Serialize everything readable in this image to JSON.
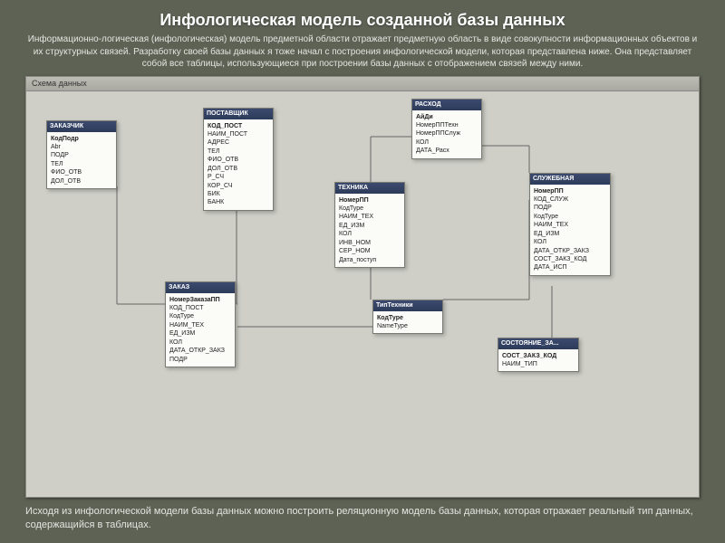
{
  "title": "Инфологическая модель созданной базы данных",
  "intro": "Информационно-логическая (инфологическая) модель предметной области отражает предметную область в виде совокупности информационных объектов и их структурных связей. Разработку своей базы данных я тоже начал с построения инфологической модели, которая представлена ниже. Она представляет собой все таблицы, использующиеся при построении базы данных с отображением связей между ними.",
  "window_title": "Схема данных",
  "outro": "Исходя из инфологической модели базы данных можно построить реляционную модель базы данных, которая отражает реальный тип данных, содержащийся в таблицах.",
  "tables": {
    "zakazchik": {
      "name": "ЗАКАЗЧИК",
      "fields": [
        "КодПодр",
        "Abr",
        "ПОДР",
        "ТЕЛ",
        "ФИО_ОТВ",
        "ДОЛ_ОТВ"
      ]
    },
    "postavshik": {
      "name": "ПОСТАВЩИК",
      "fields": [
        "КОД_ПОСТ",
        "НАИМ_ПОСТ",
        "АДРЕС",
        "ТЕЛ",
        "ФИО_ОТВ",
        "ДОЛ_ОТВ",
        "Р_СЧ",
        "КОР_СЧ",
        "БИК",
        "БАНК"
      ]
    },
    "tehnika": {
      "name": "ТЕХНИКА",
      "fields": [
        "НомерПП",
        "КодТуре",
        "НАИМ_ТЕХ",
        "ЕД_ИЗМ",
        "КОЛ",
        "ИНВ_НОМ",
        "СЕР_НОМ",
        "Дата_поступ"
      ]
    },
    "rashod": {
      "name": "РАСХОД",
      "fields": [
        "АйДи",
        "НомерППТехн",
        "НомерППСлуж",
        "КОЛ",
        "ДАТА_Расх"
      ]
    },
    "sluzhebnaya": {
      "name": "СЛУЖЕБНАЯ",
      "fields": [
        "НомерПП",
        "КОД_СЛУЖ",
        "ПОДР",
        "КодТуре",
        "НАИМ_ТЕХ",
        "ЕД_ИЗМ",
        "КОЛ",
        "ДАТА_ОТКР_ЗАКЗ",
        "СОСТ_ЗАКЗ_КОД",
        "ДАТА_ИСП"
      ]
    },
    "zakaz": {
      "name": "ЗАКАЗ",
      "fields": [
        "НомерЗаказаПП",
        "КОД_ПОСТ",
        "КодТуре",
        "НАИМ_ТЕХ",
        "ЕД_ИЗМ",
        "КОЛ",
        "ДАТА_ОТКР_ЗАКЗ",
        "ПОДР"
      ]
    },
    "tiptehniki": {
      "name": "ТипТехники",
      "fields": [
        "КодТуре",
        "NameType"
      ]
    },
    "sostoyanie": {
      "name": "СОСТОЯНИЕ_ЗА...",
      "fields": [
        "СОСТ_ЗАКЗ_КОД",
        "НАИМ_ТИП"
      ]
    }
  },
  "chart_data": {
    "type": "diagram",
    "title": "Схема данных (ER-модель базы данных)",
    "entities": [
      {
        "id": "zakazchik",
        "name": "ЗАКАЗЧИК",
        "pk": "КодПодр"
      },
      {
        "id": "postavshik",
        "name": "ПОСТАВЩИК",
        "pk": "КОД_ПОСТ"
      },
      {
        "id": "tehnika",
        "name": "ТЕХНИКА",
        "pk": "НомерПП"
      },
      {
        "id": "rashod",
        "name": "РАСХОД",
        "pk": "АйДи"
      },
      {
        "id": "sluzhebnaya",
        "name": "СЛУЖЕБНАЯ",
        "pk": "НомерПП"
      },
      {
        "id": "zakaz",
        "name": "ЗАКАЗ",
        "pk": "НомерЗаказаПП"
      },
      {
        "id": "tiptehniki",
        "name": "ТипТехники",
        "pk": "КодТуре"
      },
      {
        "id": "sostoyanie",
        "name": "СОСТОЯНИЕ_ЗАКАЗА",
        "pk": "СОСТ_ЗАКЗ_КОД"
      }
    ],
    "relationships": [
      {
        "from": "zakazchik",
        "to": "zakaz",
        "type": "1:N"
      },
      {
        "from": "postavshik",
        "to": "zakaz",
        "type": "1:N"
      },
      {
        "from": "zakaz",
        "to": "tiptehniki",
        "type": "N:1"
      },
      {
        "from": "tiptehniki",
        "to": "tehnika",
        "type": "1:N"
      },
      {
        "from": "tiptehniki",
        "to": "sluzhebnaya",
        "type": "1:N"
      },
      {
        "from": "tehnika",
        "to": "rashod",
        "type": "1:N"
      },
      {
        "from": "sluzhebnaya",
        "to": "rashod",
        "type": "1:N"
      },
      {
        "from": "sostoyanie",
        "to": "sluzhebnaya",
        "type": "1:N"
      },
      {
        "from": "zakazchik",
        "to": "sluzhebnaya",
        "type": "1:N"
      }
    ]
  }
}
